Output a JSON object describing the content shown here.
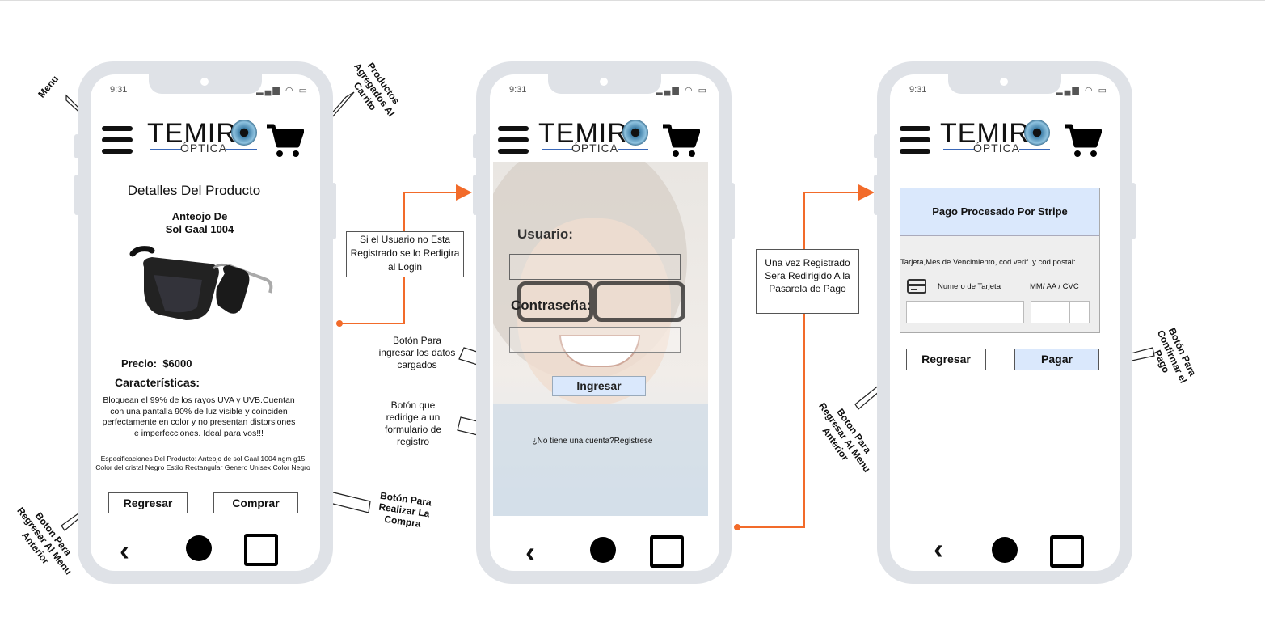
{
  "status": {
    "time": "9:31"
  },
  "header": {
    "logo_word": "TEMIR",
    "logo_sub": "ÓPTICA"
  },
  "screen1": {
    "title": "Detalles Del Producto",
    "product_name_1": "Anteojo De",
    "product_name_2": "Sol Gaal 1004",
    "price_label": "Precio:",
    "price_value": "$6000",
    "features_title": "Características:",
    "features_text": "Bloquean el 99% de los rayos UVA y UVB.Cuentan con una pantalla 90% de luz visible y coinciden perfectamente en color y no presentan distorsiones e imperfecciones. Ideal para vos!!!",
    "specs_text": "Especificaciones Del Producto: Anteojo de sol Gaal 1004 ngm g15 Color del cristal Negro Estilo Rectangular Genero Unisex Color Negro",
    "back_button": "Regresar",
    "buy_button": "Comprar"
  },
  "screen2": {
    "user_label": "Usuario:",
    "password_label": "Contraseña:",
    "login_button": "Ingresar",
    "register_link": "¿No tiene una cuenta?Registrese"
  },
  "screen3": {
    "stripe_title": "Pago Procesado Por Stripe",
    "card_info_label": "Tarjeta,Mes de Vencimiento, cod.verif. y cod.postal:",
    "card_number_label": "Numero de Tarjeta",
    "card_expiry_label": "MM/ AA / CVC",
    "back_button": "Regresar",
    "pay_button": "Pagar"
  },
  "annotations": {
    "menu": "Menu",
    "cart": "Productos Agregados Al Carrito",
    "back1": "Boton Para Regresar Al Menu Anterior",
    "buy": "Botón Para Realizar La Compra",
    "login_redirect": "Si el Usuario no Esta Registrado se lo Redigira al Login",
    "login_button": "Botón Para ingresar los datos cargados",
    "register": "Botón que redirige a un formulario de registro",
    "payment_redirect": "Una vez Registrado Sera Redirigido A la Pasarela de Pago",
    "back3": "Boton Para Regresar Al Menu Anterior",
    "confirm": "Botón Para Confirmar el Pago"
  },
  "colors": {
    "phone_frame": "#dfe2e7",
    "accent_connector": "#f26b2a",
    "stripe_header": "#dae8fc",
    "primary_button": "#dae8fc"
  }
}
